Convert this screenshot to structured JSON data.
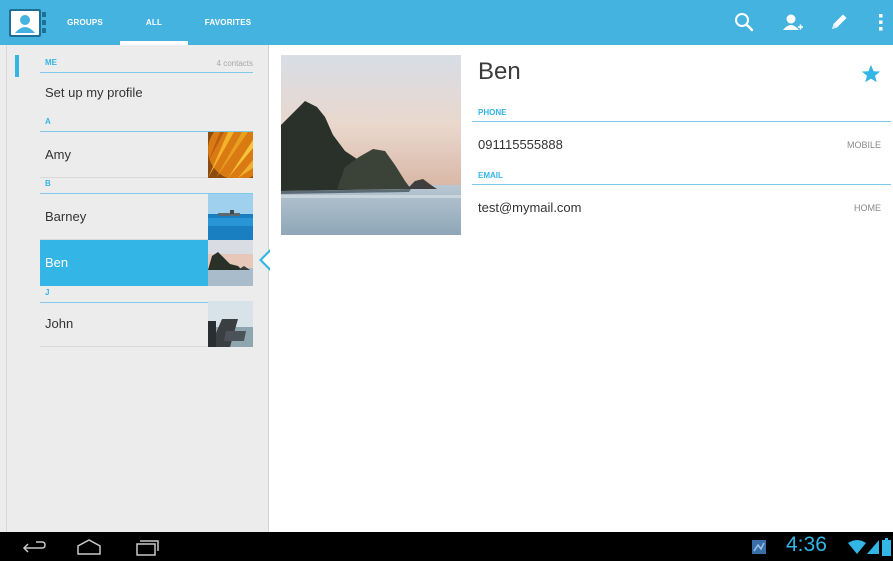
{
  "actionbar": {
    "tabs": [
      {
        "label": "GROUPS"
      },
      {
        "label": "ALL"
      },
      {
        "label": "FAVORITES"
      }
    ],
    "actions": [
      "search-icon",
      "add-contact-icon",
      "edit-icon",
      "overflow-menu-icon"
    ]
  },
  "contacts": {
    "me_section": {
      "label": "ME",
      "count": "4 contacts"
    },
    "profile": {
      "label": "Set up my profile"
    },
    "sections": [
      {
        "letter": "A",
        "entries": [
          "Amy"
        ]
      },
      {
        "letter": "B",
        "entries": [
          "Barney",
          "Ben"
        ]
      },
      {
        "letter": "J",
        "entries": [
          "John"
        ]
      }
    ],
    "selected": "Ben"
  },
  "detail": {
    "name": "Ben",
    "starred": true,
    "phone": {
      "header": "PHONE",
      "value": "091115555888",
      "type": "MOBILE"
    },
    "email": {
      "header": "EMAIL",
      "value": "test@mymail.com",
      "type": "HOME"
    }
  },
  "status": {
    "time": "4:36"
  },
  "colors": {
    "accent": "#33b5e5",
    "actionbar": "#45b3e0"
  }
}
